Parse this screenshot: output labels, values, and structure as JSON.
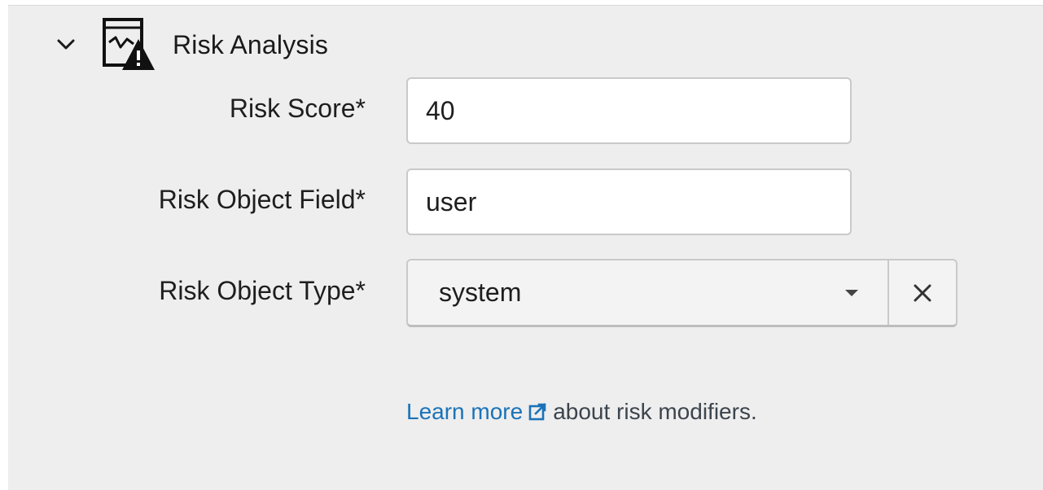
{
  "section": {
    "title": "Risk Analysis",
    "collapse_icon": "chevron-down-icon",
    "icon": "risk-analysis-chart-warning-icon"
  },
  "fields": {
    "risk_score": {
      "label": "Risk Score*",
      "value": "40"
    },
    "risk_object_field": {
      "label": "Risk Object Field*",
      "value": "user"
    },
    "risk_object_type": {
      "label": "Risk Object Type*",
      "selected": "system",
      "dropdown_icon": "caret-down-icon",
      "clear_icon": "close-icon"
    }
  },
  "help": {
    "link_text": "Learn more",
    "link_icon": "external-link-icon",
    "suffix": "about risk modifiers."
  },
  "colors": {
    "panel_bg": "#eeeeee",
    "link": "#1a73b8",
    "text": "#1e1e1e",
    "border": "#c9c9c9"
  }
}
